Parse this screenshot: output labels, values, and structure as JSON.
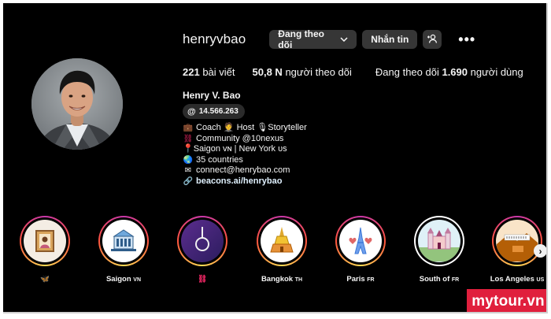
{
  "profile": {
    "username": "henryvbao",
    "follow_button": "Đang theo dõi",
    "message_button": "Nhắn tin",
    "add_user_icon": "add-user-icon",
    "more_icon": "more-options-icon",
    "more_glyph": "•••"
  },
  "stats": {
    "posts_count": "221",
    "posts_label": " bài viết",
    "followers_count": "50,8 N",
    "followers_label": " người theo dõi",
    "following_prefix": "Đang theo dõi ",
    "following_count": "1.690",
    "following_label": " người dùng"
  },
  "bio": {
    "full_name": "Henry V. Bao",
    "threads_handle": "14.566.263",
    "lines": [
      "Coach 🤵 Host 🎙Storyteller",
      "Community @10nexus",
      "📍Saigon ᴠɴ | New York ᴜs",
      "35 countries",
      "connect@henrybao.com",
      "beacons.ai/henrybao"
    ]
  },
  "stories": [
    {
      "label": "🦋",
      "suffix": ""
    },
    {
      "label": "Saigon ",
      "suffix": "VN"
    },
    {
      "label": "",
      "suffix": ""
    },
    {
      "label": "Bangkok ",
      "suffix": "TH"
    },
    {
      "label": "Paris ",
      "suffix": "FR"
    },
    {
      "label": "South of ",
      "suffix": "FR"
    },
    {
      "label": "Los Angeles ",
      "suffix": "US"
    }
  ],
  "watermark": "mytour.vn",
  "colors": {
    "background": "#000000",
    "button": "#363636",
    "ring_gradient_start": "#c837ab",
    "watermark": "#e01f3d"
  }
}
